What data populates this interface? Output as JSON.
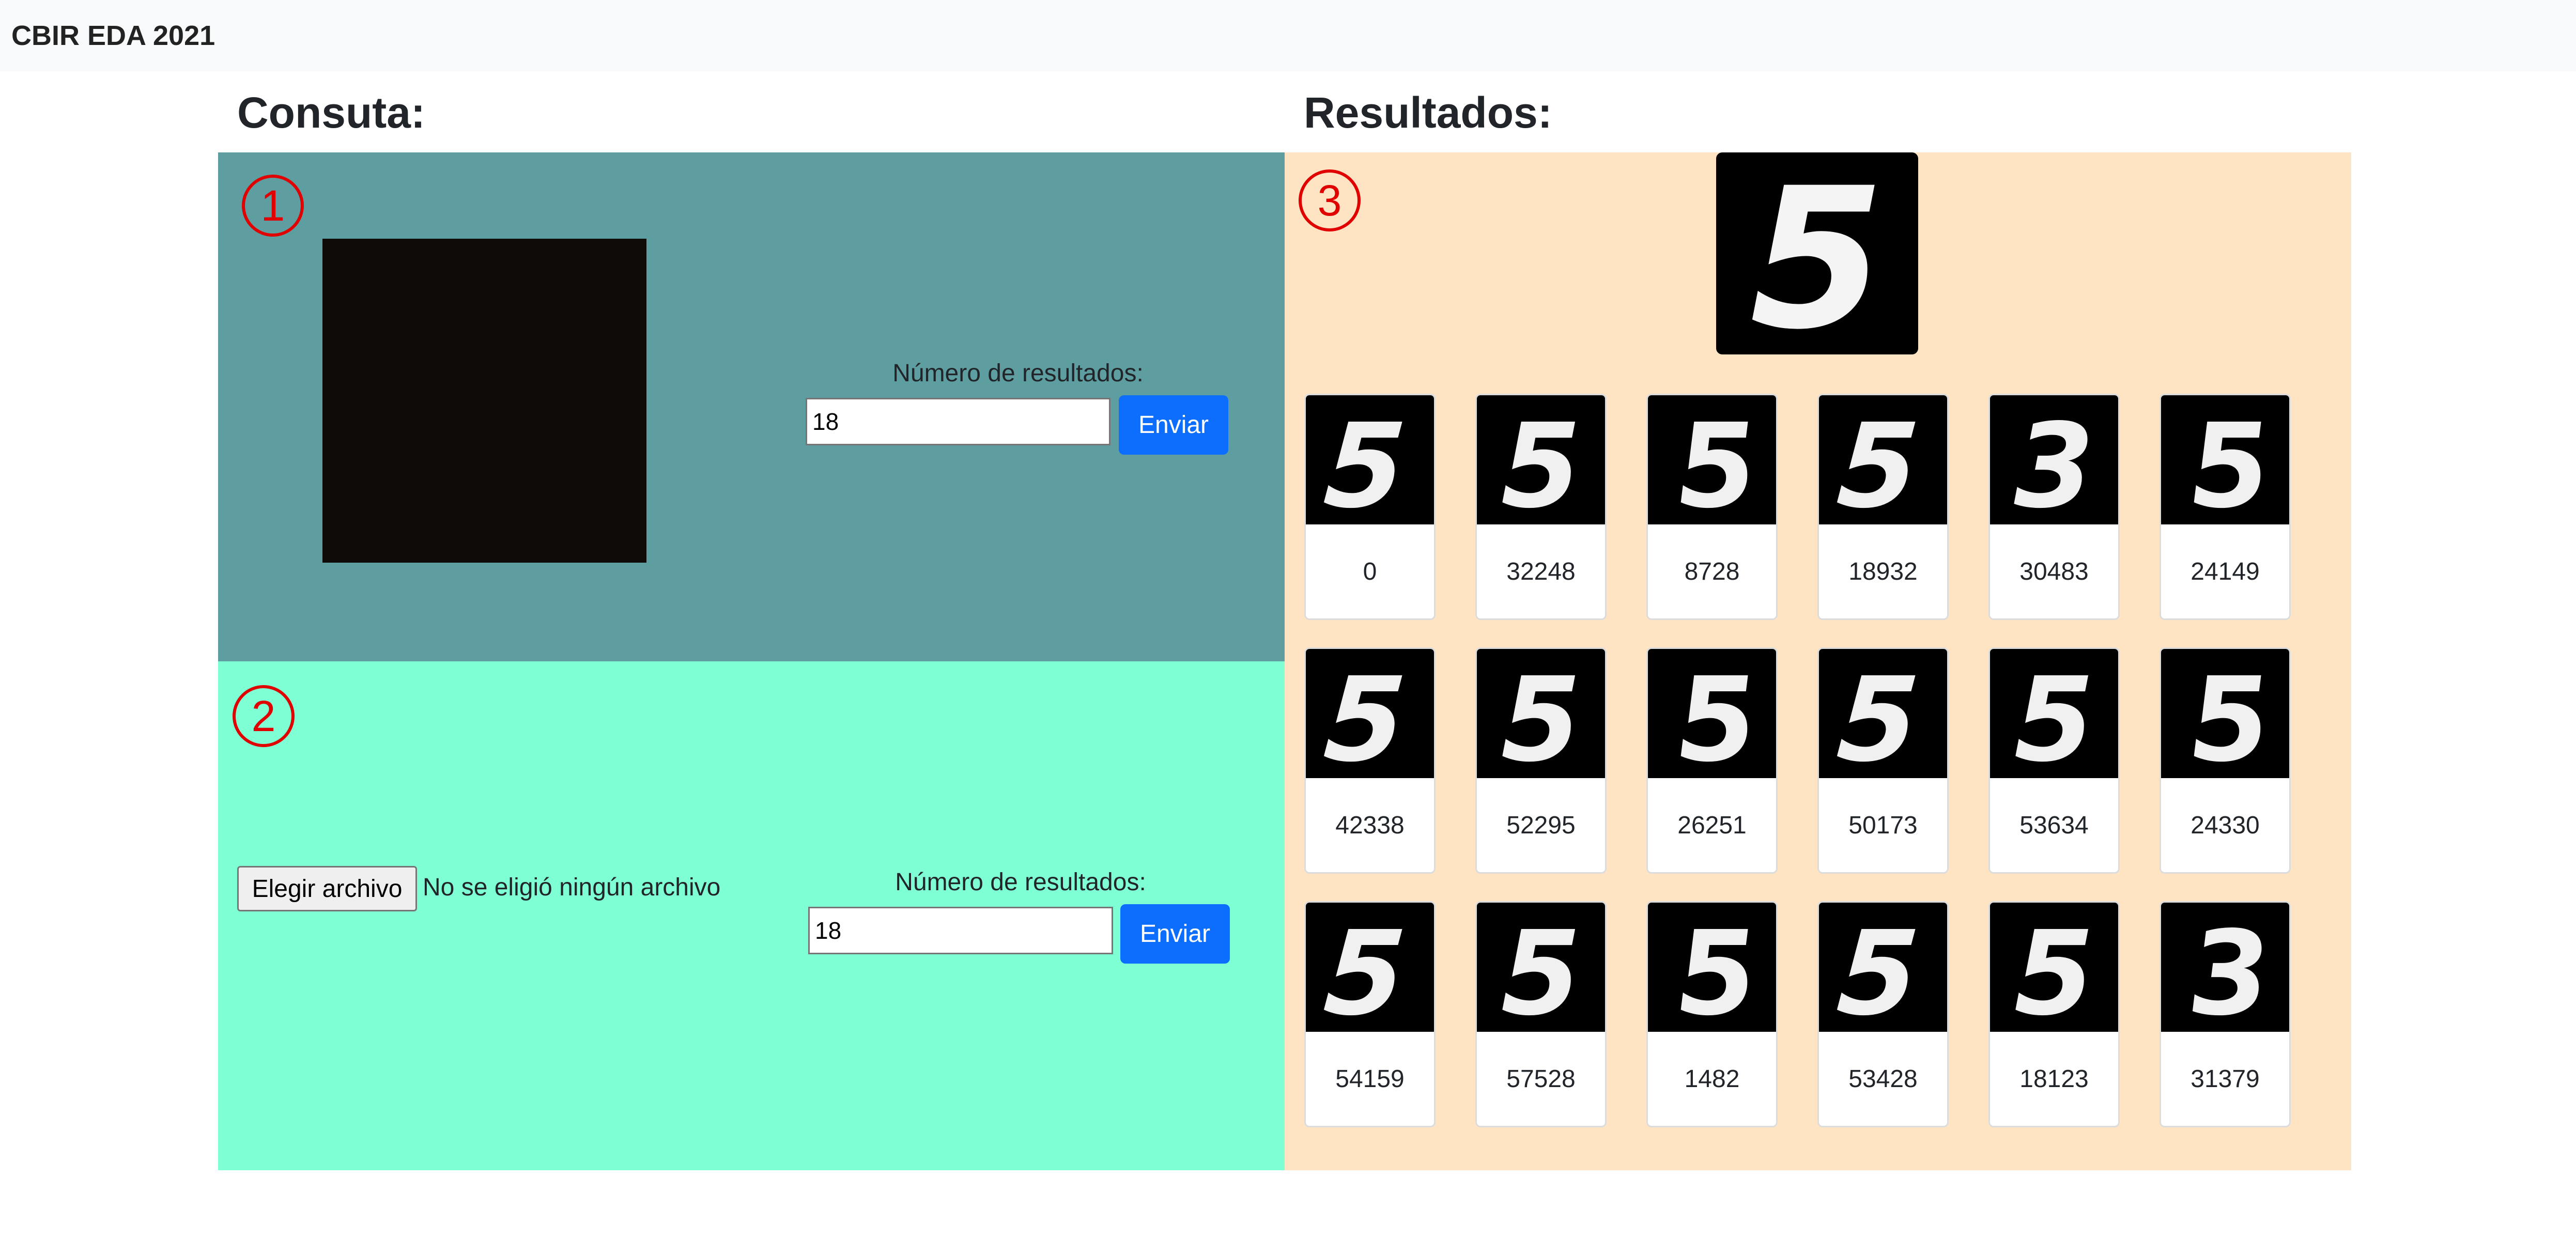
{
  "navbar": {
    "brand": "CBIR EDA 2021"
  },
  "headings": {
    "query": "Consuta:",
    "results": "Resultados:"
  },
  "markers": [
    "1",
    "2",
    "3"
  ],
  "canvas_panel": {
    "label": "Número de resultados:",
    "input_value": "18",
    "send_label": "Enviar",
    "canvas_color": "#0f0b09",
    "bg_color": "#5f9ea0"
  },
  "upload_panel": {
    "file_button_label": "Elegir archivo",
    "file_status": "No se eligió ningún archivo",
    "label": "Número de resultados:",
    "input_value": "18",
    "send_label": "Enviar",
    "bg_color": "#7fffd4"
  },
  "results_panel": {
    "bg_color": "#ffe4c4",
    "query_digit": "5",
    "results": [
      {
        "id": "0",
        "digit": "5"
      },
      {
        "id": "32248",
        "digit": "5"
      },
      {
        "id": "8728",
        "digit": "5"
      },
      {
        "id": "18932",
        "digit": "5"
      },
      {
        "id": "30483",
        "digit": "3"
      },
      {
        "id": "24149",
        "digit": "5"
      },
      {
        "id": "42338",
        "digit": "5"
      },
      {
        "id": "52295",
        "digit": "5"
      },
      {
        "id": "26251",
        "digit": "5"
      },
      {
        "id": "50173",
        "digit": "5"
      },
      {
        "id": "53634",
        "digit": "5"
      },
      {
        "id": "24330",
        "digit": "5"
      },
      {
        "id": "54159",
        "digit": "5"
      },
      {
        "id": "57528",
        "digit": "5"
      },
      {
        "id": "1482",
        "digit": "5"
      },
      {
        "id": "53428",
        "digit": "5"
      },
      {
        "id": "18123",
        "digit": "5"
      },
      {
        "id": "31379",
        "digit": "3"
      }
    ]
  },
  "colors": {
    "primary_button": "#0d6efd",
    "marker": "#e00000"
  }
}
